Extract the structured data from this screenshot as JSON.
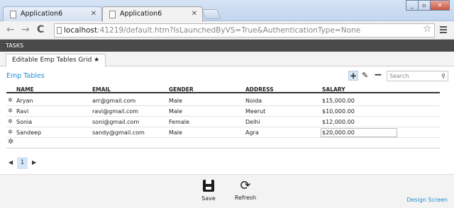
{
  "browser": {
    "tabs": [
      {
        "title": "Application6"
      },
      {
        "title": "Application6"
      }
    ],
    "url_host": "localhost",
    "url_rest": ":41219/default.htm?IsLaunchedByVS=True&AuthenticationType=None"
  },
  "app": {
    "tasks_label": "TASKS",
    "screen_tab": "Editable Emp Tables Grid ★",
    "grid_title": "Emp Tables",
    "search_placeholder": "Search",
    "columns": [
      "NAME",
      "EMAIL",
      "GENDER",
      "ADDRESS",
      "SALARY"
    ],
    "rows": [
      {
        "name": "Aryan",
        "email": "arr@gmail.com",
        "gender": "Male",
        "address": "Noida",
        "salary": "$15,000.00"
      },
      {
        "name": "Ravi",
        "email": "ravi@gmail.com",
        "gender": "Male",
        "address": "Meerut",
        "salary": "$10,000.00"
      },
      {
        "name": "Sonia",
        "email": "soni@gmail.com",
        "gender": "Female",
        "address": "Delhi",
        "salary": "$12,000.00"
      },
      {
        "name": "Sandeep",
        "email": "sandy@gmail.com",
        "gender": "Male",
        "address": "Agra",
        "salary": "$20,000.00"
      }
    ],
    "pager": {
      "current_page": "1"
    },
    "footer": {
      "save_label": "Save",
      "refresh_label": "Refresh",
      "design_link": "Design Screen"
    }
  },
  "colors": {
    "accent": "#1e8fd0",
    "tasks_bar": "#4a4a4a"
  }
}
